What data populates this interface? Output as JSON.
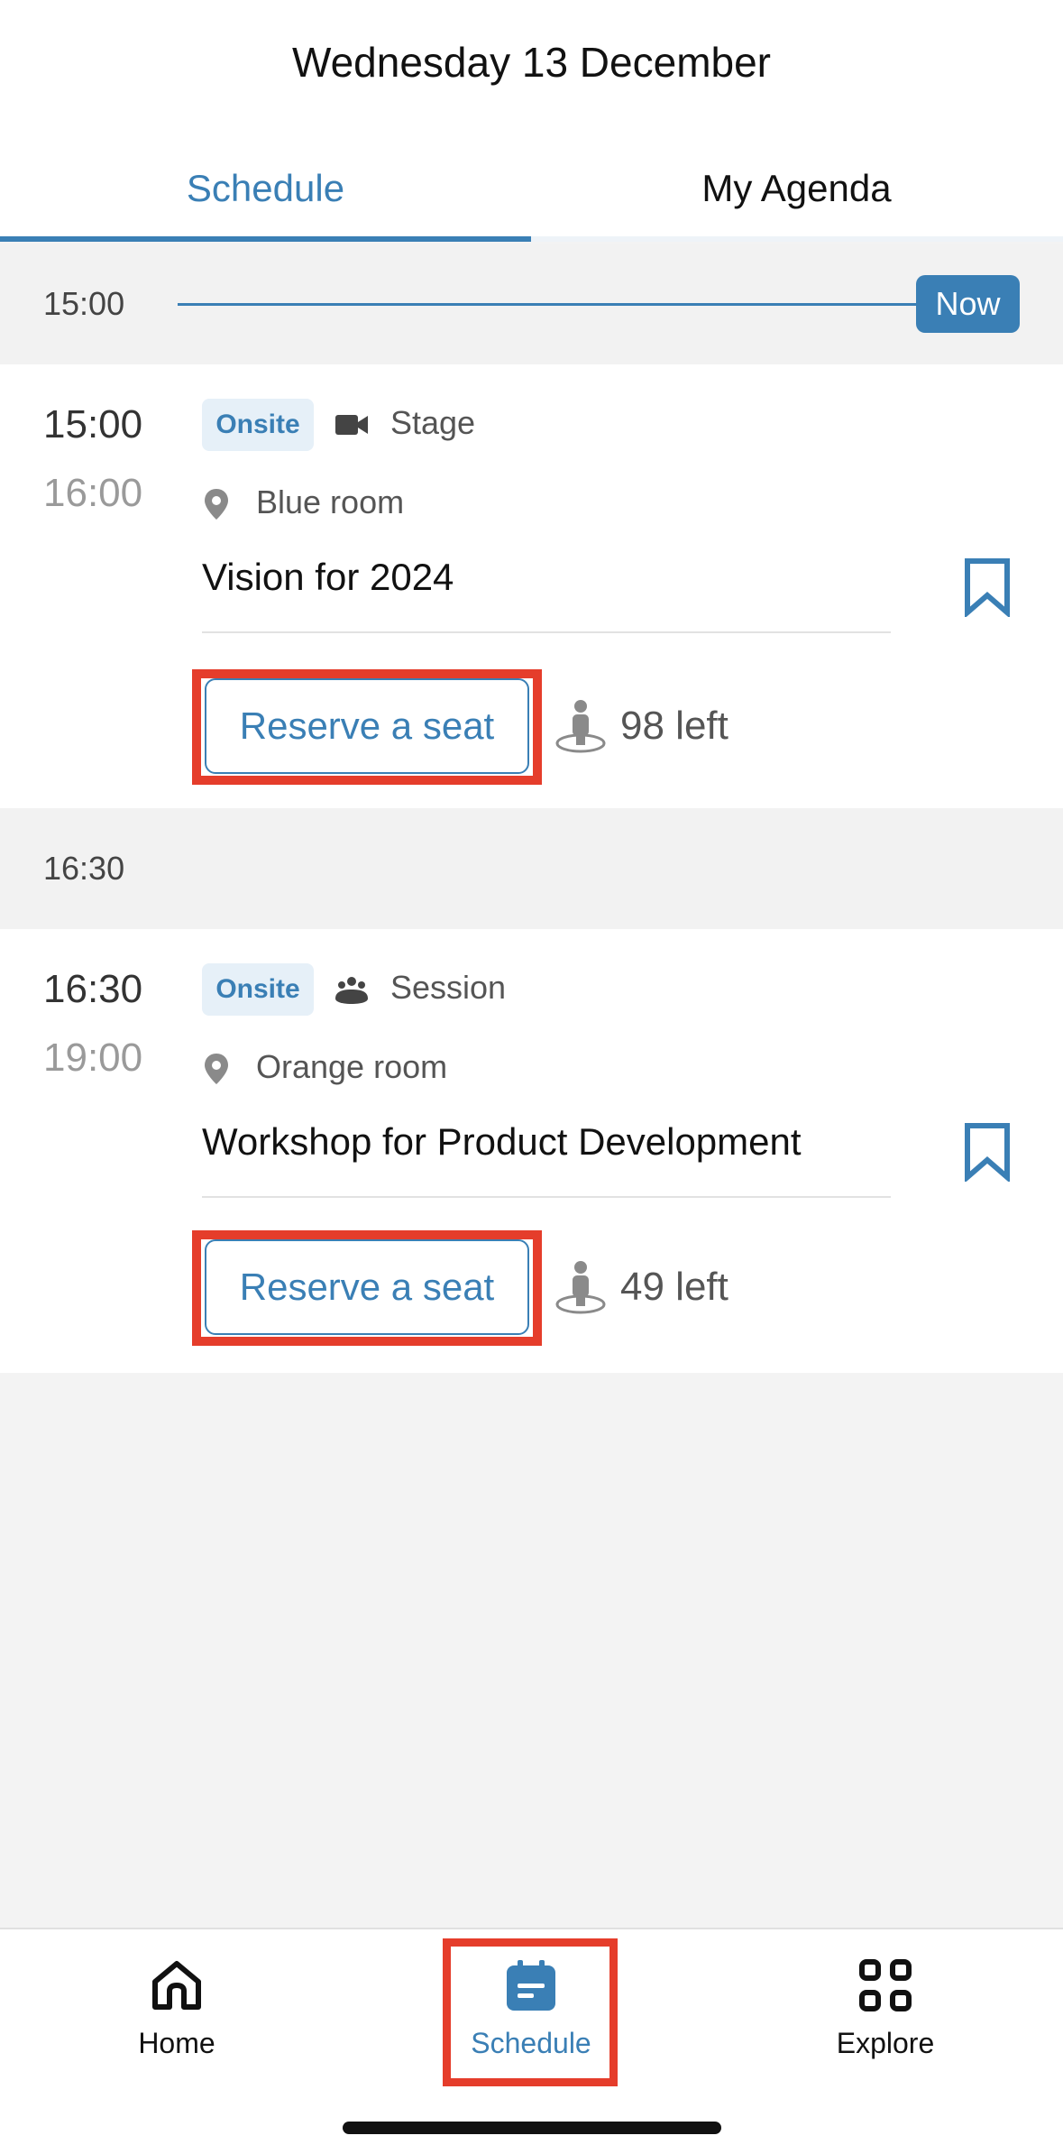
{
  "header": {
    "title": "Wednesday 13 December"
  },
  "tabs": [
    {
      "label": "Schedule",
      "active": true
    },
    {
      "label": "My Agenda",
      "active": false
    }
  ],
  "separators": [
    {
      "time": "15:00",
      "now_label": "Now"
    },
    {
      "time": "16:30"
    }
  ],
  "sessions": [
    {
      "start": "15:00",
      "end": "16:00",
      "tag": "Onsite",
      "type_icon": "video-camera-icon",
      "type": "Stage",
      "room": "Blue room",
      "title": "Vision for 2024",
      "reserve_label": "Reserve a seat",
      "seats_left": "98 left"
    },
    {
      "start": "16:30",
      "end": "19:00",
      "tag": "Onsite",
      "type_icon": "group-icon",
      "type": "Session",
      "room": "Orange room",
      "title": "Workshop for Product Development",
      "reserve_label": "Reserve a seat",
      "seats_left": "49 left"
    }
  ],
  "bottom_nav": [
    {
      "label": "Home",
      "icon": "home-icon",
      "active": false
    },
    {
      "label": "Schedule",
      "icon": "calendar-icon",
      "active": true
    },
    {
      "label": "Explore",
      "icon": "grid-icon",
      "active": false
    }
  ],
  "colors": {
    "accent": "#3a7fb5",
    "highlight": "#e53d2b",
    "background": "#f3f3f3",
    "tag_bg": "#e6f0f8"
  }
}
